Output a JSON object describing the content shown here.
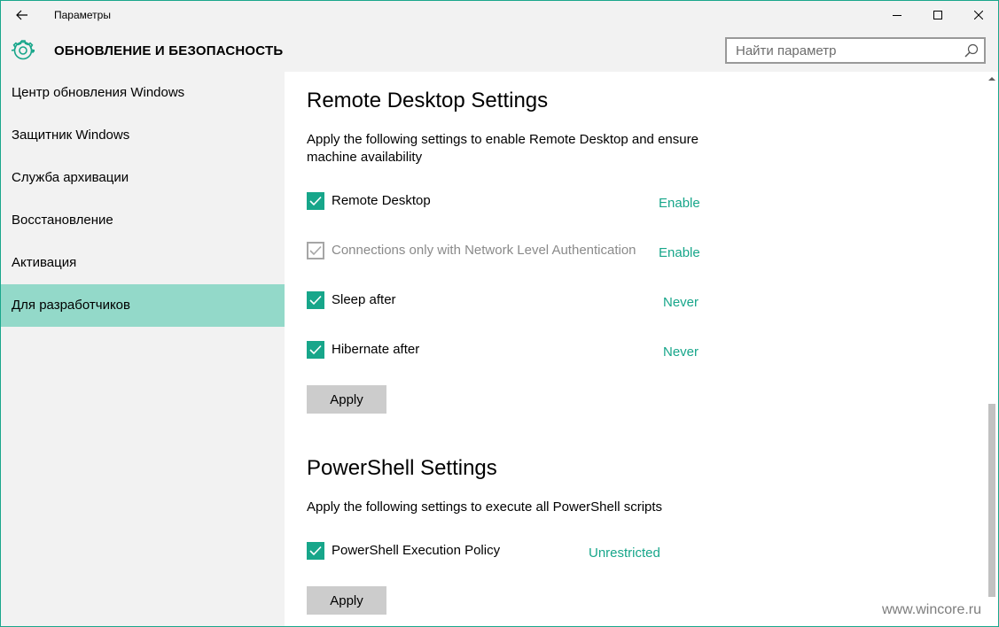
{
  "window": {
    "app_title": "Параметры"
  },
  "header": {
    "section_title": "ОБНОВЛЕНИЕ И БЕЗОПАСНОСТЬ",
    "search_placeholder": "Найти параметр"
  },
  "sidebar": {
    "items": [
      {
        "label": "Центр обновления Windows"
      },
      {
        "label": "Защитник Windows"
      },
      {
        "label": "Служба архивации"
      },
      {
        "label": "Восстановление"
      },
      {
        "label": "Активация"
      },
      {
        "label": "Для разработчиков",
        "active": true
      }
    ]
  },
  "remote_desktop": {
    "title": "Remote Desktop Settings",
    "description": "Apply the following settings to enable Remote Desktop and ensure machine availability",
    "settings": [
      {
        "label": "Remote Desktop",
        "value": "Enable",
        "checked": true,
        "disabled": false
      },
      {
        "label": "Connections only with Network Level Authentication",
        "value": "Enable",
        "checked": true,
        "disabled": true
      },
      {
        "label": "Sleep after",
        "value": "Never",
        "checked": true,
        "disabled": false
      },
      {
        "label": "Hibernate after",
        "value": "Never",
        "checked": true,
        "disabled": false
      }
    ],
    "apply_label": "Apply"
  },
  "powershell": {
    "title": "PowerShell Settings",
    "description": "Apply the following settings to execute all PowerShell scripts",
    "settings": [
      {
        "label": "PowerShell Execution Policy",
        "value": "Unrestricted",
        "checked": true,
        "disabled": false
      }
    ],
    "apply_label": "Apply"
  },
  "watermark": "www.wincore.ru",
  "colors": {
    "accent": "#17a68a",
    "selected_nav": "#93d9c9",
    "chrome_bg": "#f2f2f2",
    "window_border": "#1aa78c"
  }
}
